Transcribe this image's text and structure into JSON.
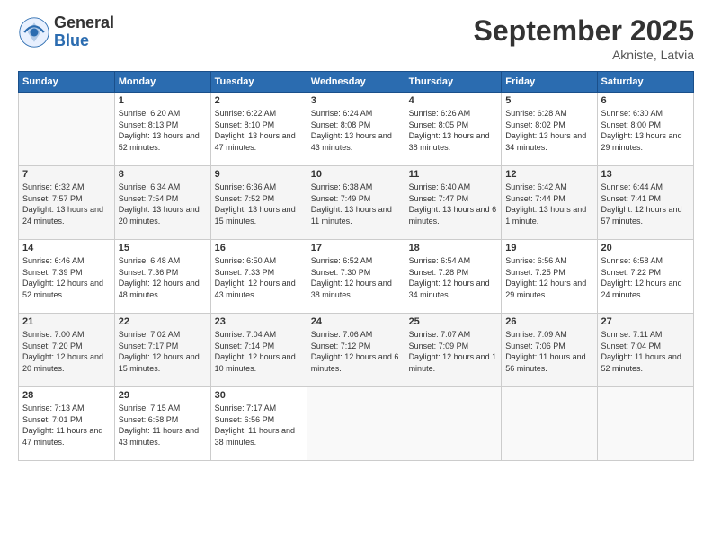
{
  "logo": {
    "general": "General",
    "blue": "Blue"
  },
  "header": {
    "month": "September 2025",
    "location": "Akniste, Latvia"
  },
  "weekdays": [
    "Sunday",
    "Monday",
    "Tuesday",
    "Wednesday",
    "Thursday",
    "Friday",
    "Saturday"
  ],
  "weeks": [
    [
      {
        "day": "",
        "sunrise": "",
        "sunset": "",
        "daylight": ""
      },
      {
        "day": "1",
        "sunrise": "Sunrise: 6:20 AM",
        "sunset": "Sunset: 8:13 PM",
        "daylight": "Daylight: 13 hours and 52 minutes."
      },
      {
        "day": "2",
        "sunrise": "Sunrise: 6:22 AM",
        "sunset": "Sunset: 8:10 PM",
        "daylight": "Daylight: 13 hours and 47 minutes."
      },
      {
        "day": "3",
        "sunrise": "Sunrise: 6:24 AM",
        "sunset": "Sunset: 8:08 PM",
        "daylight": "Daylight: 13 hours and 43 minutes."
      },
      {
        "day": "4",
        "sunrise": "Sunrise: 6:26 AM",
        "sunset": "Sunset: 8:05 PM",
        "daylight": "Daylight: 13 hours and 38 minutes."
      },
      {
        "day": "5",
        "sunrise": "Sunrise: 6:28 AM",
        "sunset": "Sunset: 8:02 PM",
        "daylight": "Daylight: 13 hours and 34 minutes."
      },
      {
        "day": "6",
        "sunrise": "Sunrise: 6:30 AM",
        "sunset": "Sunset: 8:00 PM",
        "daylight": "Daylight: 13 hours and 29 minutes."
      }
    ],
    [
      {
        "day": "7",
        "sunrise": "Sunrise: 6:32 AM",
        "sunset": "Sunset: 7:57 PM",
        "daylight": "Daylight: 13 hours and 24 minutes."
      },
      {
        "day": "8",
        "sunrise": "Sunrise: 6:34 AM",
        "sunset": "Sunset: 7:54 PM",
        "daylight": "Daylight: 13 hours and 20 minutes."
      },
      {
        "day": "9",
        "sunrise": "Sunrise: 6:36 AM",
        "sunset": "Sunset: 7:52 PM",
        "daylight": "Daylight: 13 hours and 15 minutes."
      },
      {
        "day": "10",
        "sunrise": "Sunrise: 6:38 AM",
        "sunset": "Sunset: 7:49 PM",
        "daylight": "Daylight: 13 hours and 11 minutes."
      },
      {
        "day": "11",
        "sunrise": "Sunrise: 6:40 AM",
        "sunset": "Sunset: 7:47 PM",
        "daylight": "Daylight: 13 hours and 6 minutes."
      },
      {
        "day": "12",
        "sunrise": "Sunrise: 6:42 AM",
        "sunset": "Sunset: 7:44 PM",
        "daylight": "Daylight: 13 hours and 1 minute."
      },
      {
        "day": "13",
        "sunrise": "Sunrise: 6:44 AM",
        "sunset": "Sunset: 7:41 PM",
        "daylight": "Daylight: 12 hours and 57 minutes."
      }
    ],
    [
      {
        "day": "14",
        "sunrise": "Sunrise: 6:46 AM",
        "sunset": "Sunset: 7:39 PM",
        "daylight": "Daylight: 12 hours and 52 minutes."
      },
      {
        "day": "15",
        "sunrise": "Sunrise: 6:48 AM",
        "sunset": "Sunset: 7:36 PM",
        "daylight": "Daylight: 12 hours and 48 minutes."
      },
      {
        "day": "16",
        "sunrise": "Sunrise: 6:50 AM",
        "sunset": "Sunset: 7:33 PM",
        "daylight": "Daylight: 12 hours and 43 minutes."
      },
      {
        "day": "17",
        "sunrise": "Sunrise: 6:52 AM",
        "sunset": "Sunset: 7:30 PM",
        "daylight": "Daylight: 12 hours and 38 minutes."
      },
      {
        "day": "18",
        "sunrise": "Sunrise: 6:54 AM",
        "sunset": "Sunset: 7:28 PM",
        "daylight": "Daylight: 12 hours and 34 minutes."
      },
      {
        "day": "19",
        "sunrise": "Sunrise: 6:56 AM",
        "sunset": "Sunset: 7:25 PM",
        "daylight": "Daylight: 12 hours and 29 minutes."
      },
      {
        "day": "20",
        "sunrise": "Sunrise: 6:58 AM",
        "sunset": "Sunset: 7:22 PM",
        "daylight": "Daylight: 12 hours and 24 minutes."
      }
    ],
    [
      {
        "day": "21",
        "sunrise": "Sunrise: 7:00 AM",
        "sunset": "Sunset: 7:20 PM",
        "daylight": "Daylight: 12 hours and 20 minutes."
      },
      {
        "day": "22",
        "sunrise": "Sunrise: 7:02 AM",
        "sunset": "Sunset: 7:17 PM",
        "daylight": "Daylight: 12 hours and 15 minutes."
      },
      {
        "day": "23",
        "sunrise": "Sunrise: 7:04 AM",
        "sunset": "Sunset: 7:14 PM",
        "daylight": "Daylight: 12 hours and 10 minutes."
      },
      {
        "day": "24",
        "sunrise": "Sunrise: 7:06 AM",
        "sunset": "Sunset: 7:12 PM",
        "daylight": "Daylight: 12 hours and 6 minutes."
      },
      {
        "day": "25",
        "sunrise": "Sunrise: 7:07 AM",
        "sunset": "Sunset: 7:09 PM",
        "daylight": "Daylight: 12 hours and 1 minute."
      },
      {
        "day": "26",
        "sunrise": "Sunrise: 7:09 AM",
        "sunset": "Sunset: 7:06 PM",
        "daylight": "Daylight: 11 hours and 56 minutes."
      },
      {
        "day": "27",
        "sunrise": "Sunrise: 7:11 AM",
        "sunset": "Sunset: 7:04 PM",
        "daylight": "Daylight: 11 hours and 52 minutes."
      }
    ],
    [
      {
        "day": "28",
        "sunrise": "Sunrise: 7:13 AM",
        "sunset": "Sunset: 7:01 PM",
        "daylight": "Daylight: 11 hours and 47 minutes."
      },
      {
        "day": "29",
        "sunrise": "Sunrise: 7:15 AM",
        "sunset": "Sunset: 6:58 PM",
        "daylight": "Daylight: 11 hours and 43 minutes."
      },
      {
        "day": "30",
        "sunrise": "Sunrise: 7:17 AM",
        "sunset": "Sunset: 6:56 PM",
        "daylight": "Daylight: 11 hours and 38 minutes."
      },
      {
        "day": "",
        "sunrise": "",
        "sunset": "",
        "daylight": ""
      },
      {
        "day": "",
        "sunrise": "",
        "sunset": "",
        "daylight": ""
      },
      {
        "day": "",
        "sunrise": "",
        "sunset": "",
        "daylight": ""
      },
      {
        "day": "",
        "sunrise": "",
        "sunset": "",
        "daylight": ""
      }
    ]
  ]
}
